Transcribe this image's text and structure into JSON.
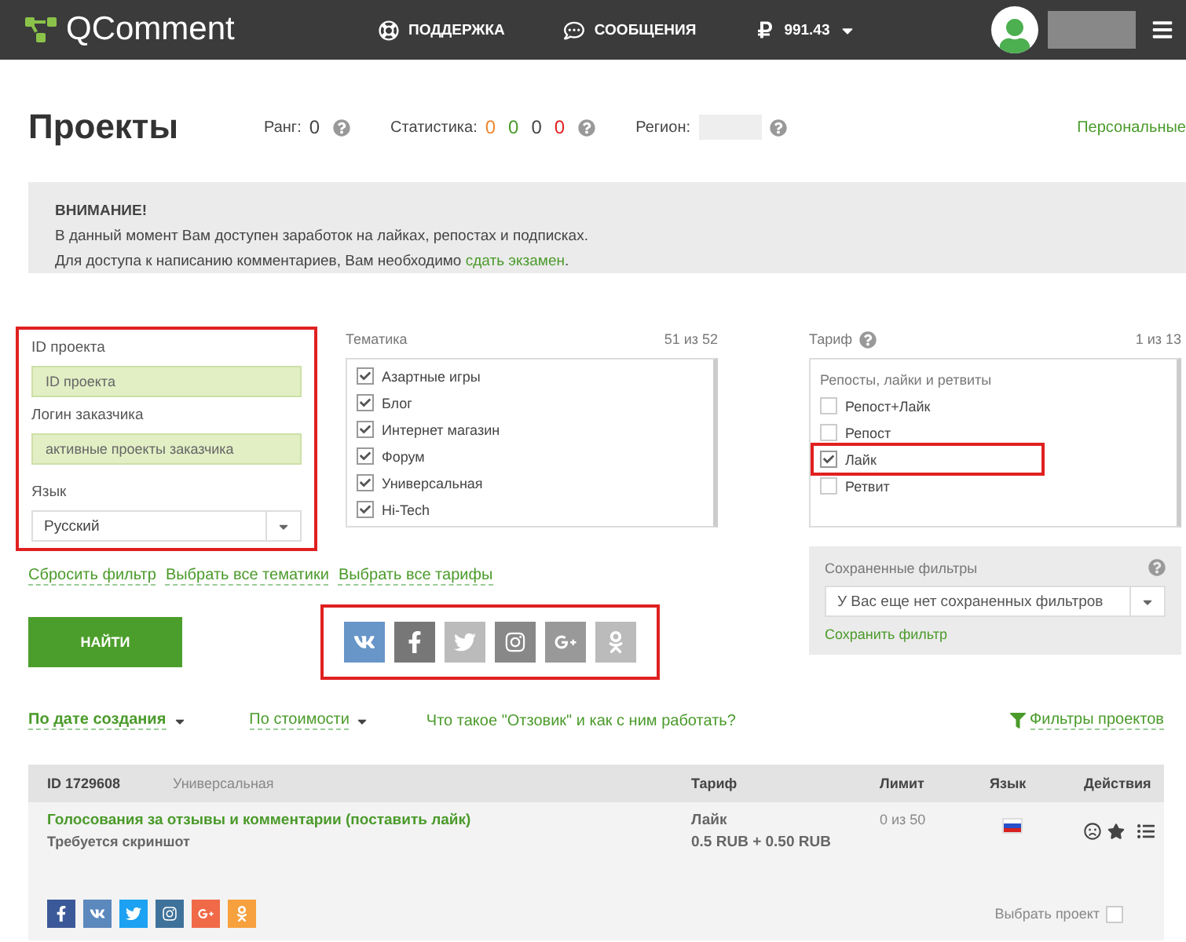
{
  "header": {
    "logo": "QComment",
    "nav": [
      {
        "kind": "support",
        "label": "ПОДДЕРЖКА"
      },
      {
        "kind": "messages",
        "label": "СООБЩЕНИЯ"
      }
    ],
    "balance": "991.43"
  },
  "page": {
    "title": "Проекты",
    "rank_label": "Ранг:",
    "rank": "0",
    "stats_label": "Статистика:",
    "stats": [
      {
        "value": "0",
        "color": "#f0862f"
      },
      {
        "value": "0",
        "color": "#4a9a2a"
      },
      {
        "value": "0",
        "color": "#444444"
      },
      {
        "value": "0",
        "color": "#e02020"
      }
    ],
    "region_label": "Регион:",
    "personal_link": "Персональные"
  },
  "notice": {
    "title": "ВНИМАНИЕ!",
    "line1": "В данный момент Вам доступен заработок на лайках, репостах и подписках.",
    "line2": "Для доступа к написанию комментариев, Вам необходимо ",
    "link": "сдать экзамен",
    "end": "."
  },
  "filter": {
    "highlighted": true,
    "id_label": "ID проекта",
    "id_placeholder": "ID проекта",
    "login_label": "Логин заказчика",
    "login_placeholder": "активные проекты заказчика",
    "lang_label": "Язык",
    "lang_value": "Русский"
  },
  "topics": {
    "label": "Тематика",
    "count": "51 из 52",
    "items": [
      {
        "label": "Азартные игры",
        "checked": true
      },
      {
        "label": "Блог",
        "checked": true
      },
      {
        "label": "Интернет магазин",
        "checked": true
      },
      {
        "label": "Форум",
        "checked": true
      },
      {
        "label": "Универсальная",
        "checked": true
      },
      {
        "label": "Hi-Tech",
        "checked": true
      }
    ]
  },
  "tariff": {
    "label": "Тариф",
    "count": "1 из 13",
    "group": "Репосты, лайки и ретвиты",
    "items": [
      {
        "label": "Репост+Лайк",
        "checked": false,
        "highlighted": false
      },
      {
        "label": "Репост",
        "checked": false,
        "highlighted": false
      },
      {
        "label": "Лайк",
        "checked": true,
        "highlighted": true
      },
      {
        "label": "Ретвит",
        "checked": false,
        "highlighted": false
      }
    ]
  },
  "saved_filters": {
    "label": "Сохраненные фильтры",
    "value": "У Вас еще нет сохраненных фильтров",
    "save_link": "Сохранить фильтр"
  },
  "links": [
    "Сбросить фильтр",
    "Выбрать все тематики",
    "Выбрать все тарифы"
  ],
  "search_button": "НАЙТИ",
  "networks": {
    "highlighted": true,
    "items": [
      {
        "kind": "vk",
        "selected": true
      },
      {
        "kind": "facebook",
        "selected": false
      },
      {
        "kind": "twitter",
        "selected": false
      },
      {
        "kind": "instagram",
        "selected": false
      },
      {
        "kind": "googleplus",
        "selected": false
      },
      {
        "kind": "ok",
        "selected": false
      }
    ]
  },
  "sort": [
    {
      "label": "По дате создания",
      "selected": true
    },
    {
      "label": "По стоимости",
      "selected": false
    }
  ],
  "help_link": "Что такое \"Отзовик\" и как с ним работать?",
  "filters_link": "Фильтры проектов",
  "project": {
    "id": "ID 1729608",
    "topic": "Универсальная",
    "col_tariff": "Тариф",
    "col_limit": "Лимит",
    "col_lang": "Язык",
    "col_actions": "Действия",
    "title": "Голосования за отзывы и комментарии (поставить лайк)",
    "note": "Требуется скриншот",
    "tariff": "Лайк",
    "price": "0.5 RUB + 0.50 RUB",
    "limit": "0 из 50",
    "networks": [
      {
        "kind": "facebook"
      },
      {
        "kind": "vk"
      },
      {
        "kind": "twitter"
      },
      {
        "kind": "instagram"
      },
      {
        "kind": "googleplus"
      },
      {
        "kind": "ok"
      }
    ],
    "select_label": "Выбрать проект",
    "selected": false
  }
}
